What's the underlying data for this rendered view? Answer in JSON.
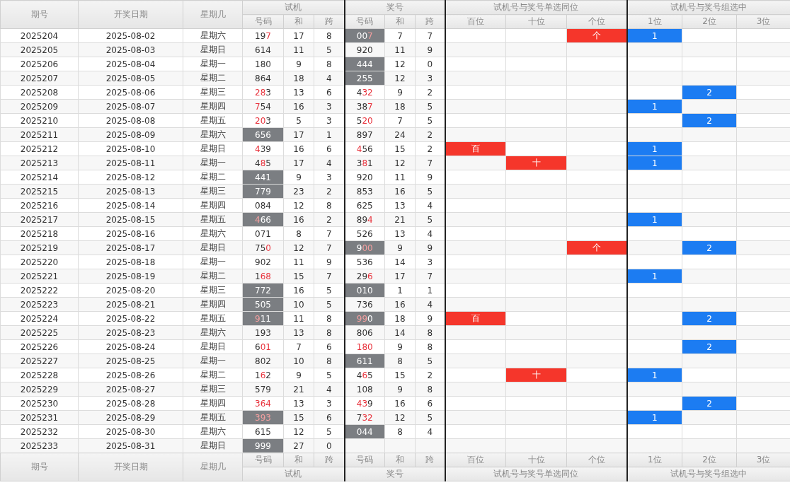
{
  "header": {
    "columns": [
      "期号",
      "开奖日期",
      "星期几"
    ],
    "groups": [
      {
        "title": "试机",
        "sub": [
          "号码",
          "和",
          "跨"
        ]
      },
      {
        "title": "奖号",
        "sub": [
          "号码",
          "和",
          "跨"
        ]
      },
      {
        "title": "试机号与奖号单选同位",
        "sub": [
          "百位",
          "十位",
          "个位"
        ]
      },
      {
        "title": "试机号与奖号组选中",
        "sub": [
          "1位",
          "2位",
          "3位"
        ]
      }
    ]
  },
  "rows": [
    {
      "period": "2025204",
      "date": "2025-08-02",
      "weekday": "星期六",
      "test": {
        "text": "197",
        "red": [
          false,
          false,
          true
        ],
        "shaded": false
      },
      "test_sum": "17",
      "test_span": "8",
      "prize": {
        "text": "007",
        "red": [
          false,
          false,
          true
        ],
        "shaded": true
      },
      "prize_sum": "7",
      "prize_span": "7",
      "same": [
        {
          "hit": false
        },
        {
          "hit": false
        },
        {
          "hit": true,
          "text": "个"
        }
      ],
      "group": [
        {
          "hit": true,
          "text": "1"
        },
        {
          "hit": false
        },
        {
          "hit": false
        }
      ]
    },
    {
      "period": "2025205",
      "date": "2025-08-03",
      "weekday": "星期日",
      "test": {
        "text": "614",
        "red": [
          false,
          false,
          false
        ],
        "shaded": false
      },
      "test_sum": "11",
      "test_span": "5",
      "prize": {
        "text": "920",
        "red": [
          false,
          false,
          false
        ],
        "shaded": false
      },
      "prize_sum": "11",
      "prize_span": "9",
      "same": [
        {
          "hit": false
        },
        {
          "hit": false
        },
        {
          "hit": false
        }
      ],
      "group": [
        {
          "hit": false
        },
        {
          "hit": false
        },
        {
          "hit": false
        }
      ]
    },
    {
      "period": "2025206",
      "date": "2025-08-04",
      "weekday": "星期一",
      "test": {
        "text": "180",
        "red": [
          false,
          false,
          false
        ],
        "shaded": false
      },
      "test_sum": "9",
      "test_span": "8",
      "prize": {
        "text": "444",
        "red": [
          false,
          false,
          false
        ],
        "shaded": true
      },
      "prize_sum": "12",
      "prize_span": "0",
      "same": [
        {
          "hit": false
        },
        {
          "hit": false
        },
        {
          "hit": false
        }
      ],
      "group": [
        {
          "hit": false
        },
        {
          "hit": false
        },
        {
          "hit": false
        }
      ]
    },
    {
      "period": "2025207",
      "date": "2025-08-05",
      "weekday": "星期二",
      "test": {
        "text": "864",
        "red": [
          false,
          false,
          false
        ],
        "shaded": false
      },
      "test_sum": "18",
      "test_span": "4",
      "prize": {
        "text": "255",
        "red": [
          false,
          false,
          false
        ],
        "shaded": true
      },
      "prize_sum": "12",
      "prize_span": "3",
      "same": [
        {
          "hit": false
        },
        {
          "hit": false
        },
        {
          "hit": false
        }
      ],
      "group": [
        {
          "hit": false
        },
        {
          "hit": false
        },
        {
          "hit": false
        }
      ]
    },
    {
      "period": "2025208",
      "date": "2025-08-06",
      "weekday": "星期三",
      "test": {
        "text": "283",
        "red": [
          true,
          true,
          false
        ],
        "shaded": false
      },
      "test_sum": "13",
      "test_span": "6",
      "prize": {
        "text": "432",
        "red": [
          false,
          true,
          true
        ],
        "shaded": false
      },
      "prize_sum": "9",
      "prize_span": "2",
      "same": [
        {
          "hit": false
        },
        {
          "hit": false
        },
        {
          "hit": false
        }
      ],
      "group": [
        {
          "hit": false
        },
        {
          "hit": true,
          "text": "2"
        },
        {
          "hit": false
        }
      ]
    },
    {
      "period": "2025209",
      "date": "2025-08-07",
      "weekday": "星期四",
      "test": {
        "text": "754",
        "red": [
          true,
          false,
          false
        ],
        "shaded": false
      },
      "test_sum": "16",
      "test_span": "3",
      "prize": {
        "text": "387",
        "red": [
          false,
          false,
          true
        ],
        "shaded": false
      },
      "prize_sum": "18",
      "prize_span": "5",
      "same": [
        {
          "hit": false
        },
        {
          "hit": false
        },
        {
          "hit": false
        }
      ],
      "group": [
        {
          "hit": true,
          "text": "1"
        },
        {
          "hit": false
        },
        {
          "hit": false
        }
      ]
    },
    {
      "period": "2025210",
      "date": "2025-08-08",
      "weekday": "星期五",
      "test": {
        "text": "203",
        "red": [
          true,
          true,
          false
        ],
        "shaded": false
      },
      "test_sum": "5",
      "test_span": "3",
      "prize": {
        "text": "520",
        "red": [
          false,
          true,
          true
        ],
        "shaded": false
      },
      "prize_sum": "7",
      "prize_span": "5",
      "same": [
        {
          "hit": false
        },
        {
          "hit": false
        },
        {
          "hit": false
        }
      ],
      "group": [
        {
          "hit": false
        },
        {
          "hit": true,
          "text": "2"
        },
        {
          "hit": false
        }
      ]
    },
    {
      "period": "2025211",
      "date": "2025-08-09",
      "weekday": "星期六",
      "test": {
        "text": "656",
        "red": [
          false,
          false,
          false
        ],
        "shaded": true
      },
      "test_sum": "17",
      "test_span": "1",
      "prize": {
        "text": "897",
        "red": [
          false,
          false,
          false
        ],
        "shaded": false
      },
      "prize_sum": "24",
      "prize_span": "2",
      "same": [
        {
          "hit": false
        },
        {
          "hit": false
        },
        {
          "hit": false
        }
      ],
      "group": [
        {
          "hit": false
        },
        {
          "hit": false
        },
        {
          "hit": false
        }
      ]
    },
    {
      "period": "2025212",
      "date": "2025-08-10",
      "weekday": "星期日",
      "test": {
        "text": "439",
        "red": [
          true,
          false,
          false
        ],
        "shaded": false
      },
      "test_sum": "16",
      "test_span": "6",
      "prize": {
        "text": "456",
        "red": [
          true,
          false,
          false
        ],
        "shaded": false
      },
      "prize_sum": "15",
      "prize_span": "2",
      "same": [
        {
          "hit": true,
          "text": "百"
        },
        {
          "hit": false
        },
        {
          "hit": false
        }
      ],
      "group": [
        {
          "hit": true,
          "text": "1"
        },
        {
          "hit": false
        },
        {
          "hit": false
        }
      ]
    },
    {
      "period": "2025213",
      "date": "2025-08-11",
      "weekday": "星期一",
      "test": {
        "text": "485",
        "red": [
          false,
          true,
          false
        ],
        "shaded": false
      },
      "test_sum": "17",
      "test_span": "4",
      "prize": {
        "text": "381",
        "red": [
          false,
          true,
          false
        ],
        "shaded": false
      },
      "prize_sum": "12",
      "prize_span": "7",
      "same": [
        {
          "hit": false
        },
        {
          "hit": true,
          "text": "十"
        },
        {
          "hit": false
        }
      ],
      "group": [
        {
          "hit": true,
          "text": "1"
        },
        {
          "hit": false
        },
        {
          "hit": false
        }
      ]
    },
    {
      "period": "2025214",
      "date": "2025-08-12",
      "weekday": "星期二",
      "test": {
        "text": "441",
        "red": [
          false,
          false,
          false
        ],
        "shaded": true
      },
      "test_sum": "9",
      "test_span": "3",
      "prize": {
        "text": "920",
        "red": [
          false,
          false,
          false
        ],
        "shaded": false
      },
      "prize_sum": "11",
      "prize_span": "9",
      "same": [
        {
          "hit": false
        },
        {
          "hit": false
        },
        {
          "hit": false
        }
      ],
      "group": [
        {
          "hit": false
        },
        {
          "hit": false
        },
        {
          "hit": false
        }
      ]
    },
    {
      "period": "2025215",
      "date": "2025-08-13",
      "weekday": "星期三",
      "test": {
        "text": "779",
        "red": [
          false,
          false,
          false
        ],
        "shaded": true
      },
      "test_sum": "23",
      "test_span": "2",
      "prize": {
        "text": "853",
        "red": [
          false,
          false,
          false
        ],
        "shaded": false
      },
      "prize_sum": "16",
      "prize_span": "5",
      "same": [
        {
          "hit": false
        },
        {
          "hit": false
        },
        {
          "hit": false
        }
      ],
      "group": [
        {
          "hit": false
        },
        {
          "hit": false
        },
        {
          "hit": false
        }
      ]
    },
    {
      "period": "2025216",
      "date": "2025-08-14",
      "weekday": "星期四",
      "test": {
        "text": "084",
        "red": [
          false,
          false,
          false
        ],
        "shaded": false
      },
      "test_sum": "12",
      "test_span": "8",
      "prize": {
        "text": "625",
        "red": [
          false,
          false,
          false
        ],
        "shaded": false
      },
      "prize_sum": "13",
      "prize_span": "4",
      "same": [
        {
          "hit": false
        },
        {
          "hit": false
        },
        {
          "hit": false
        }
      ],
      "group": [
        {
          "hit": false
        },
        {
          "hit": false
        },
        {
          "hit": false
        }
      ]
    },
    {
      "period": "2025217",
      "date": "2025-08-15",
      "weekday": "星期五",
      "test": {
        "text": "466",
        "red": [
          true,
          false,
          false
        ],
        "shaded": true
      },
      "test_sum": "16",
      "test_span": "2",
      "prize": {
        "text": "894",
        "red": [
          false,
          false,
          true
        ],
        "shaded": false
      },
      "prize_sum": "21",
      "prize_span": "5",
      "same": [
        {
          "hit": false
        },
        {
          "hit": false
        },
        {
          "hit": false
        }
      ],
      "group": [
        {
          "hit": true,
          "text": "1"
        },
        {
          "hit": false
        },
        {
          "hit": false
        }
      ]
    },
    {
      "period": "2025218",
      "date": "2025-08-16",
      "weekday": "星期六",
      "test": {
        "text": "071",
        "red": [
          false,
          false,
          false
        ],
        "shaded": false
      },
      "test_sum": "8",
      "test_span": "7",
      "prize": {
        "text": "526",
        "red": [
          false,
          false,
          false
        ],
        "shaded": false
      },
      "prize_sum": "13",
      "prize_span": "4",
      "same": [
        {
          "hit": false
        },
        {
          "hit": false
        },
        {
          "hit": false
        }
      ],
      "group": [
        {
          "hit": false
        },
        {
          "hit": false
        },
        {
          "hit": false
        }
      ]
    },
    {
      "period": "2025219",
      "date": "2025-08-17",
      "weekday": "星期日",
      "test": {
        "text": "750",
        "red": [
          false,
          false,
          true
        ],
        "shaded": false
      },
      "test_sum": "12",
      "test_span": "7",
      "prize": {
        "text": "900",
        "red": [
          false,
          true,
          true
        ],
        "shaded": true
      },
      "prize_sum": "9",
      "prize_span": "9",
      "same": [
        {
          "hit": false
        },
        {
          "hit": false
        },
        {
          "hit": true,
          "text": "个"
        }
      ],
      "group": [
        {
          "hit": false
        },
        {
          "hit": true,
          "text": "2"
        },
        {
          "hit": false
        }
      ]
    },
    {
      "period": "2025220",
      "date": "2025-08-18",
      "weekday": "星期一",
      "test": {
        "text": "902",
        "red": [
          false,
          false,
          false
        ],
        "shaded": false
      },
      "test_sum": "11",
      "test_span": "9",
      "prize": {
        "text": "536",
        "red": [
          false,
          false,
          false
        ],
        "shaded": false
      },
      "prize_sum": "14",
      "prize_span": "3",
      "same": [
        {
          "hit": false
        },
        {
          "hit": false
        },
        {
          "hit": false
        }
      ],
      "group": [
        {
          "hit": false
        },
        {
          "hit": false
        },
        {
          "hit": false
        }
      ]
    },
    {
      "period": "2025221",
      "date": "2025-08-19",
      "weekday": "星期二",
      "test": {
        "text": "168",
        "red": [
          false,
          true,
          true
        ],
        "shaded": false
      },
      "test_sum": "15",
      "test_span": "7",
      "prize": {
        "text": "296",
        "red": [
          false,
          false,
          true
        ],
        "shaded": false
      },
      "prize_sum": "17",
      "prize_span": "7",
      "same": [
        {
          "hit": false
        },
        {
          "hit": false
        },
        {
          "hit": false
        }
      ],
      "group": [
        {
          "hit": true,
          "text": "1"
        },
        {
          "hit": false
        },
        {
          "hit": false
        }
      ]
    },
    {
      "period": "2025222",
      "date": "2025-08-20",
      "weekday": "星期三",
      "test": {
        "text": "772",
        "red": [
          false,
          false,
          false
        ],
        "shaded": true
      },
      "test_sum": "16",
      "test_span": "5",
      "prize": {
        "text": "010",
        "red": [
          false,
          false,
          false
        ],
        "shaded": true
      },
      "prize_sum": "1",
      "prize_span": "1",
      "same": [
        {
          "hit": false
        },
        {
          "hit": false
        },
        {
          "hit": false
        }
      ],
      "group": [
        {
          "hit": false
        },
        {
          "hit": false
        },
        {
          "hit": false
        }
      ]
    },
    {
      "period": "2025223",
      "date": "2025-08-21",
      "weekday": "星期四",
      "test": {
        "text": "505",
        "red": [
          false,
          false,
          false
        ],
        "shaded": true
      },
      "test_sum": "10",
      "test_span": "5",
      "prize": {
        "text": "736",
        "red": [
          false,
          false,
          false
        ],
        "shaded": false
      },
      "prize_sum": "16",
      "prize_span": "4",
      "same": [
        {
          "hit": false
        },
        {
          "hit": false
        },
        {
          "hit": false
        }
      ],
      "group": [
        {
          "hit": false
        },
        {
          "hit": false
        },
        {
          "hit": false
        }
      ]
    },
    {
      "period": "2025224",
      "date": "2025-08-22",
      "weekday": "星期五",
      "test": {
        "text": "911",
        "red": [
          true,
          false,
          false
        ],
        "shaded": true
      },
      "test_sum": "11",
      "test_span": "8",
      "prize": {
        "text": "990",
        "red": [
          true,
          true,
          false
        ],
        "shaded": true
      },
      "prize_sum": "18",
      "prize_span": "9",
      "same": [
        {
          "hit": true,
          "text": "百"
        },
        {
          "hit": false
        },
        {
          "hit": false
        }
      ],
      "group": [
        {
          "hit": false
        },
        {
          "hit": true,
          "text": "2"
        },
        {
          "hit": false
        }
      ]
    },
    {
      "period": "2025225",
      "date": "2025-08-23",
      "weekday": "星期六",
      "test": {
        "text": "193",
        "red": [
          false,
          false,
          false
        ],
        "shaded": false
      },
      "test_sum": "13",
      "test_span": "8",
      "prize": {
        "text": "806",
        "red": [
          false,
          false,
          false
        ],
        "shaded": false
      },
      "prize_sum": "14",
      "prize_span": "8",
      "same": [
        {
          "hit": false
        },
        {
          "hit": false
        },
        {
          "hit": false
        }
      ],
      "group": [
        {
          "hit": false
        },
        {
          "hit": false
        },
        {
          "hit": false
        }
      ]
    },
    {
      "period": "2025226",
      "date": "2025-08-24",
      "weekday": "星期日",
      "test": {
        "text": "601",
        "red": [
          false,
          true,
          true
        ],
        "shaded": false
      },
      "test_sum": "7",
      "test_span": "6",
      "prize": {
        "text": "180",
        "red": [
          true,
          true,
          true
        ],
        "shaded": false
      },
      "prize_sum": "9",
      "prize_span": "8",
      "same": [
        {
          "hit": false
        },
        {
          "hit": false
        },
        {
          "hit": false
        }
      ],
      "group": [
        {
          "hit": false
        },
        {
          "hit": true,
          "text": "2"
        },
        {
          "hit": false
        }
      ]
    },
    {
      "period": "2025227",
      "date": "2025-08-25",
      "weekday": "星期一",
      "test": {
        "text": "802",
        "red": [
          false,
          false,
          false
        ],
        "shaded": false
      },
      "test_sum": "10",
      "test_span": "8",
      "prize": {
        "text": "611",
        "red": [
          false,
          false,
          false
        ],
        "shaded": true
      },
      "prize_sum": "8",
      "prize_span": "5",
      "same": [
        {
          "hit": false
        },
        {
          "hit": false
        },
        {
          "hit": false
        }
      ],
      "group": [
        {
          "hit": false
        },
        {
          "hit": false
        },
        {
          "hit": false
        }
      ]
    },
    {
      "period": "2025228",
      "date": "2025-08-26",
      "weekday": "星期二",
      "test": {
        "text": "162",
        "red": [
          false,
          true,
          false
        ],
        "shaded": false
      },
      "test_sum": "9",
      "test_span": "5",
      "prize": {
        "text": "465",
        "red": [
          false,
          true,
          false
        ],
        "shaded": false
      },
      "prize_sum": "15",
      "prize_span": "2",
      "same": [
        {
          "hit": false
        },
        {
          "hit": true,
          "text": "十"
        },
        {
          "hit": false
        }
      ],
      "group": [
        {
          "hit": true,
          "text": "1"
        },
        {
          "hit": false
        },
        {
          "hit": false
        }
      ]
    },
    {
      "period": "2025229",
      "date": "2025-08-27",
      "weekday": "星期三",
      "test": {
        "text": "579",
        "red": [
          false,
          false,
          false
        ],
        "shaded": false
      },
      "test_sum": "21",
      "test_span": "4",
      "prize": {
        "text": "108",
        "red": [
          false,
          false,
          false
        ],
        "shaded": false
      },
      "prize_sum": "9",
      "prize_span": "8",
      "same": [
        {
          "hit": false
        },
        {
          "hit": false
        },
        {
          "hit": false
        }
      ],
      "group": [
        {
          "hit": false
        },
        {
          "hit": false
        },
        {
          "hit": false
        }
      ]
    },
    {
      "period": "2025230",
      "date": "2025-08-28",
      "weekday": "星期四",
      "test": {
        "text": "364",
        "red": [
          true,
          true,
          true
        ],
        "shaded": false
      },
      "test_sum": "13",
      "test_span": "3",
      "prize": {
        "text": "439",
        "red": [
          true,
          true,
          false
        ],
        "shaded": false
      },
      "prize_sum": "16",
      "prize_span": "6",
      "same": [
        {
          "hit": false
        },
        {
          "hit": false
        },
        {
          "hit": false
        }
      ],
      "group": [
        {
          "hit": false
        },
        {
          "hit": true,
          "text": "2"
        },
        {
          "hit": false
        }
      ]
    },
    {
      "period": "2025231",
      "date": "2025-08-29",
      "weekday": "星期五",
      "test": {
        "text": "393",
        "red": [
          true,
          true,
          true
        ],
        "shaded": true
      },
      "test_sum": "15",
      "test_span": "6",
      "prize": {
        "text": "732",
        "red": [
          false,
          true,
          true
        ],
        "shaded": false
      },
      "prize_sum": "12",
      "prize_span": "5",
      "same": [
        {
          "hit": false
        },
        {
          "hit": false
        },
        {
          "hit": false
        }
      ],
      "group": [
        {
          "hit": true,
          "text": "1"
        },
        {
          "hit": false
        },
        {
          "hit": false
        }
      ]
    },
    {
      "period": "2025232",
      "date": "2025-08-30",
      "weekday": "星期六",
      "test": {
        "text": "615",
        "red": [
          false,
          false,
          false
        ],
        "shaded": false
      },
      "test_sum": "12",
      "test_span": "5",
      "prize": {
        "text": "044",
        "red": [
          false,
          false,
          false
        ],
        "shaded": true
      },
      "prize_sum": "8",
      "prize_span": "4",
      "same": [
        {
          "hit": false
        },
        {
          "hit": false
        },
        {
          "hit": false
        }
      ],
      "group": [
        {
          "hit": false
        },
        {
          "hit": false
        },
        {
          "hit": false
        }
      ]
    },
    {
      "period": "2025233",
      "date": "2025-08-31",
      "weekday": "星期日",
      "test": {
        "text": "999",
        "red": [
          false,
          false,
          false
        ],
        "shaded": true
      },
      "test_sum": "27",
      "test_span": "0",
      "same": [
        {
          "hit": false
        },
        {
          "hit": false
        },
        {
          "hit": false
        }
      ],
      "group": [
        {
          "hit": false
        },
        {
          "hit": false
        },
        {
          "hit": false
        }
      ]
    }
  ],
  "footer": {
    "columns": [
      "期号",
      "开奖日期",
      "星期几"
    ],
    "groups": [
      {
        "title": "试机",
        "sub": [
          "号码",
          "和",
          "跨"
        ]
      },
      {
        "title": "奖号",
        "sub": [
          "号码",
          "和",
          "跨"
        ]
      },
      {
        "title": "试机号与奖号单选同位",
        "sub": [
          "百位",
          "十位",
          "个位"
        ]
      },
      {
        "title": "试机号与奖号组选中",
        "sub": [
          "1位",
          "2位",
          "3位"
        ]
      }
    ]
  }
}
